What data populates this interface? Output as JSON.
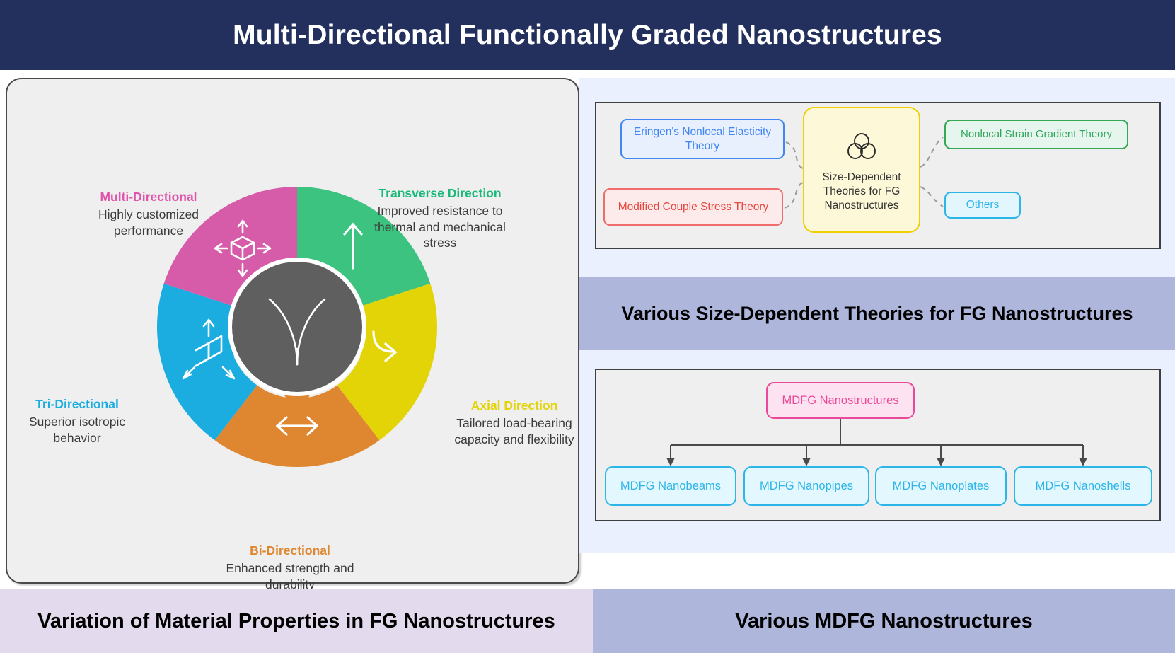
{
  "header": {
    "title": "Multi-Directional Functionally Graded Nanostructures",
    "background_color": "#23305e",
    "text_color": "#ffffff"
  },
  "left_panel": {
    "caption": "Variation of Material Properties in FG Nanostructures",
    "caption_background": "#e3dbed",
    "wheel": {
      "type": "donut",
      "center_icon": "sprout-branch-icon",
      "center_color": "#5f5f5f",
      "segments": [
        {
          "key": "transverse",
          "title": "Transverse Direction",
          "description": "Improved resistance to thermal and mechanical stress",
          "color": "#3cc37f",
          "icon": "up-arrow-icon",
          "position": "top-right"
        },
        {
          "key": "axial",
          "title": "Axial Direction",
          "description": "Tailored load-bearing capacity and flexibility",
          "color": "#e3d408",
          "icon": "curved-arrow-icon",
          "position": "right"
        },
        {
          "key": "bi",
          "title": "Bi-Directional",
          "description": "Enhanced strength and durability",
          "color": "#df8730",
          "icon": "horizontal-double-arrow-icon",
          "position": "bottom"
        },
        {
          "key": "tri",
          "title": "Tri-Directional",
          "description": "Superior isotropic behavior",
          "color": "#1bace0",
          "icon": "cube-three-axis-icon",
          "position": "left"
        },
        {
          "key": "multi",
          "title": "Multi-Directional",
          "description": "Highly customized performance",
          "color": "#d65ba8",
          "icon": "cube-four-arrow-icon",
          "position": "top-left"
        }
      ]
    }
  },
  "right_panel": {
    "background_color": "#eaf0fd",
    "middle_band": {
      "text": "Various Size-Dependent Theories for FG Nanostructures",
      "background_color": "#aeb6db"
    },
    "caption": "Various MDFG Nanostructures",
    "caption_background": "#aeb6db",
    "theories": {
      "center": {
        "label": "Size-Dependent Theories for FG Nanostructures",
        "icon": "three-circle-venn-icon",
        "fill": "#fdf8d8",
        "border": "#f0d000"
      },
      "nodes": [
        {
          "label": "Eringen's Nonlocal Elasticity Theory",
          "fill": "#e8f0fe",
          "border": "#4285f4",
          "text_color": "#4285f4"
        },
        {
          "label": "Modified Couple Stress Theory",
          "fill": "#fdeaea",
          "border": "#f06b6b",
          "text_color": "#e8453c"
        },
        {
          "label": "Nonlocal Strain Gradient Theory",
          "fill": "#e6f6ee",
          "border": "#34a853",
          "text_color": "#2ea65a"
        },
        {
          "label": "Others",
          "fill": "#e3f6fd",
          "border": "#2cb5e8",
          "text_color": "#2cb5e8"
        }
      ]
    },
    "tree": {
      "root": {
        "label": "MDFG Nanostructures",
        "fill": "#fde3f1",
        "border": "#ec4899",
        "text_color": "#ec4899"
      },
      "leaves": [
        {
          "label": "MDFG Nanobeams"
        },
        {
          "label": "MDFG Nanopipes"
        },
        {
          "label": "MDFG Nanoplates"
        },
        {
          "label": "MDFG Nanoshells"
        }
      ],
      "leaf_fill": "#e3f7fe",
      "leaf_border": "#2cb5e8",
      "leaf_text_color": "#2cb5e8"
    }
  }
}
